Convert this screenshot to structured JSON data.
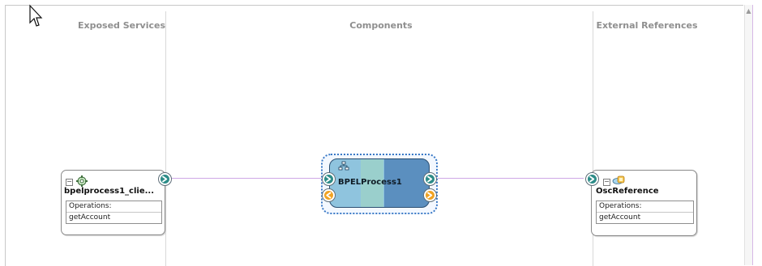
{
  "swimlanes": {
    "exposed_services": "Exposed Services",
    "components": "Components",
    "external_references": "External References"
  },
  "service": {
    "name": "bpelprocess1_clie...",
    "operations_label": "Operations:",
    "operation": "getAccount"
  },
  "component": {
    "name": "BPELProcess1"
  },
  "reference": {
    "name": "OscReference",
    "operations_label": "Operations:",
    "operation": "getAccount"
  },
  "icons": {
    "service": "gear-service-icon",
    "component": "bpel-process-icon",
    "reference": "reference-icon",
    "arrow": "arrow-right-icon"
  },
  "colors": {
    "lane_title": "#8f8f8f",
    "wire": "#cfa8e6",
    "bpel_primary": "#8fc4de",
    "bpel_secondary": "#5b8fbf",
    "accent_teal": "#2d8c88",
    "accent_orange": "#f0a324"
  }
}
